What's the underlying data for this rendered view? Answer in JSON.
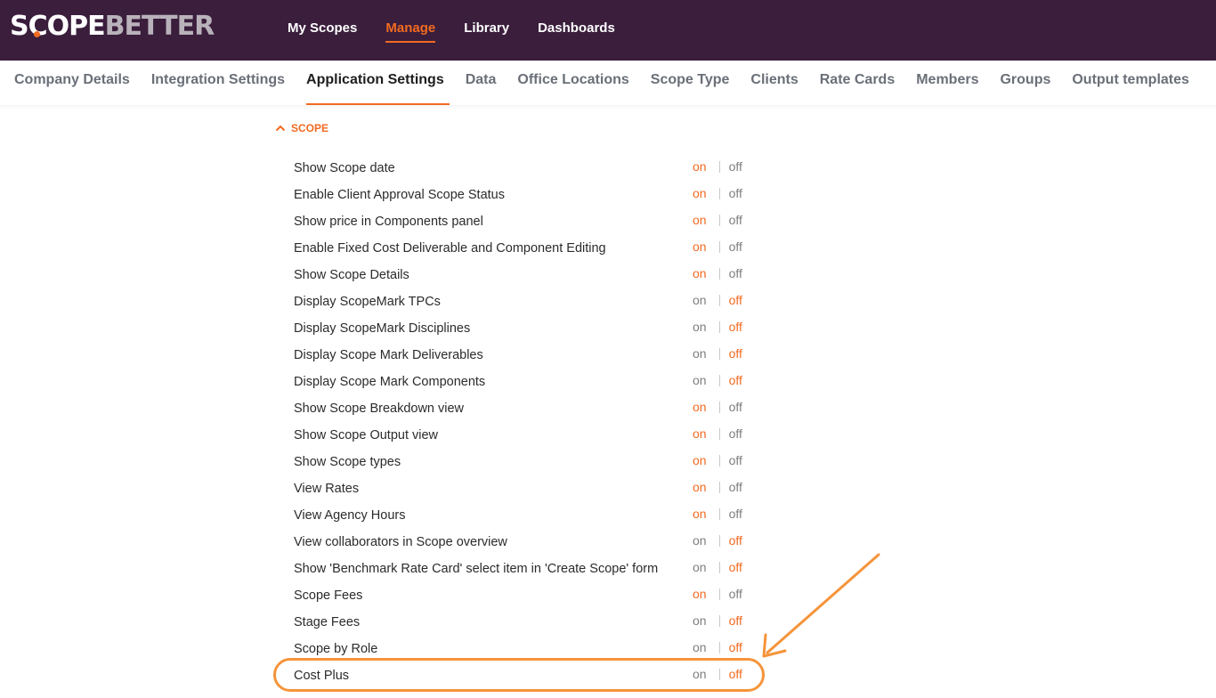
{
  "logo": {
    "part1": "SCOPE",
    "part2": "BETTER"
  },
  "main_nav": [
    {
      "label": "My Scopes",
      "active": false
    },
    {
      "label": "Manage",
      "active": true
    },
    {
      "label": "Library",
      "active": false
    },
    {
      "label": "Dashboards",
      "active": false
    }
  ],
  "sub_nav": [
    {
      "label": "Company Details",
      "active": false
    },
    {
      "label": "Integration Settings",
      "active": false
    },
    {
      "label": "Application Settings",
      "active": true
    },
    {
      "label": "Data",
      "active": false
    },
    {
      "label": "Office Locations",
      "active": false
    },
    {
      "label": "Scope Type",
      "active": false
    },
    {
      "label": "Clients",
      "active": false
    },
    {
      "label": "Rate Cards",
      "active": false
    },
    {
      "label": "Members",
      "active": false
    },
    {
      "label": "Groups",
      "active": false
    },
    {
      "label": "Output templates",
      "active": false
    }
  ],
  "section": {
    "title": "SCOPE"
  },
  "toggle_labels": {
    "on": "on",
    "off": "off"
  },
  "settings": [
    {
      "label": "Show Scope date",
      "value": "on"
    },
    {
      "label": "Enable Client Approval Scope Status",
      "value": "on"
    },
    {
      "label": "Show price in Components panel",
      "value": "on"
    },
    {
      "label": "Enable Fixed Cost Deliverable and Component Editing",
      "value": "on"
    },
    {
      "label": "Show Scope Details",
      "value": "on"
    },
    {
      "label": "Display ScopeMark TPCs",
      "value": "off"
    },
    {
      "label": "Display ScopeMark Disciplines",
      "value": "off"
    },
    {
      "label": "Display Scope Mark Deliverables",
      "value": "off"
    },
    {
      "label": "Display Scope Mark Components",
      "value": "off"
    },
    {
      "label": "Show Scope Breakdown view",
      "value": "on"
    },
    {
      "label": "Show Scope Output view",
      "value": "on"
    },
    {
      "label": "Show Scope types",
      "value": "on"
    },
    {
      "label": "View Rates",
      "value": "on"
    },
    {
      "label": "View Agency Hours",
      "value": "on"
    },
    {
      "label": "View collaborators in Scope overview",
      "value": "off"
    },
    {
      "label": "Show 'Benchmark Rate Card' select item in 'Create Scope' form",
      "value": "off"
    },
    {
      "label": "Scope Fees",
      "value": "on"
    },
    {
      "label": "Stage Fees",
      "value": "off"
    },
    {
      "label": "Scope by Role",
      "value": "off"
    },
    {
      "label": "Cost Plus",
      "value": "off"
    }
  ],
  "colors": {
    "accent": "#f26a21",
    "topbar": "#3a1e3c",
    "annotation": "#f5943a"
  }
}
